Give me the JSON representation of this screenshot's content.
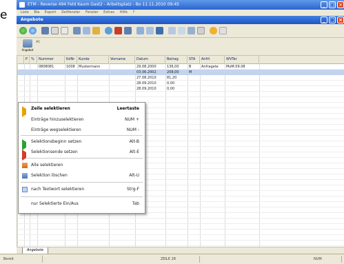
{
  "left_word": "e",
  "window": {
    "title": "ETM - Reverse 494 Feld Kaum Gast2 - Arbeitsplatz - Bo 11.11.2010 09:45",
    "menu": [
      "Liste",
      "Bla",
      "Export",
      "Zeitfenster",
      "Fenster",
      "Extras",
      "Hilfe",
      "?"
    ]
  },
  "frame": {
    "title": "Angebote"
  },
  "subtoolbar": {
    "button_label": "Angebot",
    "badge": "#1"
  },
  "grid": {
    "columns": [
      "",
      "P",
      "%",
      "Nummer",
      "KdNr",
      "Kunde",
      "Vorname",
      "Datum",
      "Betrag",
      "STA",
      "Anfrt",
      "WVTer"
    ],
    "rows": [
      [
        "",
        "",
        "",
        "0808081",
        "1008",
        "Mustermann",
        "",
        "29.08.2000",
        "136,00",
        "B",
        "Anfragete",
        "MoM.09.08"
      ],
      [
        "",
        "",
        "",
        "",
        "",
        "",
        "",
        "03.06.2002",
        "208,00",
        "M",
        "",
        ""
      ],
      [
        "",
        "",
        "",
        "",
        "",
        "",
        "",
        "27.08.2010",
        "81,20",
        "",
        "",
        ""
      ],
      [
        "",
        "",
        "",
        "",
        "",
        "",
        "",
        "28.09.2010",
        "0,00",
        "",
        "",
        ""
      ],
      [
        "",
        "",
        "",
        "",
        "",
        "",
        "",
        "28.09.2010",
        "0,00",
        "",
        "",
        ""
      ]
    ]
  },
  "context_menu": {
    "items": [
      {
        "label": "Zeile selektieren",
        "shortcut": "Leertaste",
        "icon": "arrow-right-yellow-icon",
        "bold": true
      },
      {
        "label": "Einträge hinzuselektieren",
        "shortcut": "NUM +",
        "icon": "",
        "bold": false
      },
      {
        "label": "Einträge wegselektieren",
        "shortcut": "NUM -",
        "icon": "",
        "bold": false
      },
      {
        "label": "Selektionsbeginn setzen",
        "shortcut": "Alt-B",
        "icon": "arrow-right-green-icon",
        "bold": false
      },
      {
        "label": "Selektionsende setzen",
        "shortcut": "Alt-E",
        "icon": "arrow-right-red-icon",
        "bold": false
      },
      {
        "label": "Alle selektieren",
        "shortcut": "",
        "icon": "grid-icon",
        "bold": false
      },
      {
        "label": "Selektion löschen",
        "shortcut": "Alt-U",
        "icon": "table-clear-icon",
        "bold": false
      },
      {
        "label": "nach Textwort selektieren",
        "shortcut": "Strg-F",
        "icon": "text-select-icon",
        "bold": false
      },
      {
        "label": "nur Selektierte Ein/Aus",
        "shortcut": "Tab",
        "icon": "",
        "bold": false
      }
    ]
  },
  "tab": {
    "label": "Angebote"
  },
  "statusbar": {
    "left": "Bereit",
    "center": "ZEILE 28",
    "right": "NUM"
  },
  "colors": {
    "title_blue": "#2b63d0",
    "selection": "#c3d4ef"
  }
}
